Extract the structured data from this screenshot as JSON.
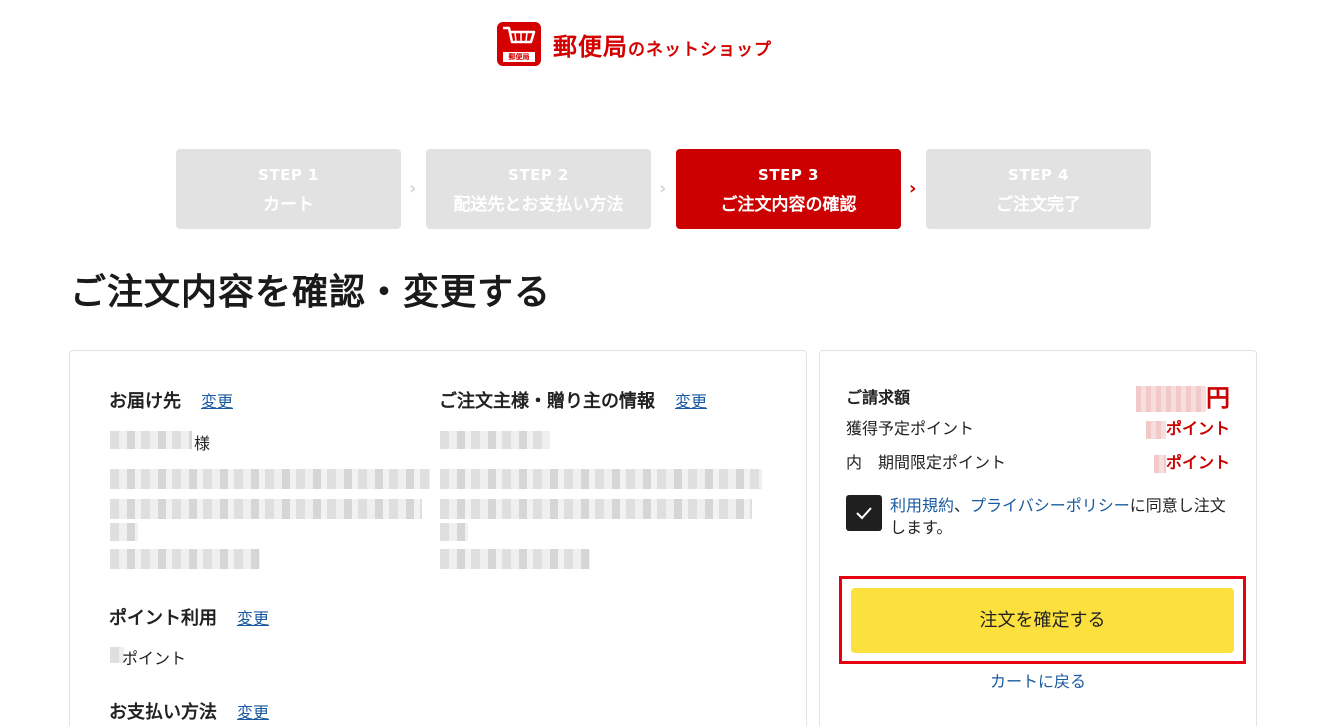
{
  "logo": {
    "badge_text": "郵便局",
    "name_main": "郵便局",
    "name_sub": "のネットショップ"
  },
  "steps": [
    {
      "no": "STEP 1",
      "name": "カート",
      "state": "inactive"
    },
    {
      "no": "STEP 2",
      "name": "配送先とお支払い方法",
      "state": "inactive"
    },
    {
      "no": "STEP 3",
      "name": "ご注文内容の確認",
      "state": "active"
    },
    {
      "no": "STEP 4",
      "name": "ご注文完了",
      "state": "inactive"
    }
  ],
  "page_title": "ご注文内容を確認・変更する",
  "left": {
    "delivery": {
      "title": "お届け先",
      "change": "変更",
      "honorific": "様"
    },
    "orderer": {
      "title": "ご注文主様・贈り主の情報",
      "change": "変更"
    },
    "points": {
      "title": "ポイント利用",
      "change": "変更",
      "unit": "ポイント"
    },
    "payment": {
      "title": "お支払い方法",
      "change": "変更"
    }
  },
  "right": {
    "billing_label": "ご請求額",
    "billing_unit": "円",
    "earn_label": "獲得予定ポイント",
    "earn_unit": "ポイント",
    "limited_label": "内　期間限定ポイント",
    "limited_unit": "ポイント",
    "agree_link1": "利用規約",
    "agree_sep": "、",
    "agree_link2": "プライバシーポリシー",
    "agree_rest": "に同意し注文します。",
    "agree_checked": true,
    "confirm_button": "注文を確定する",
    "back_link": "カートに戻る"
  },
  "colors": {
    "accent_red": "#cc0000",
    "confirm_yellow": "#fce03e",
    "link_blue": "#1a5aa0",
    "highlight_border": "#e60012"
  }
}
